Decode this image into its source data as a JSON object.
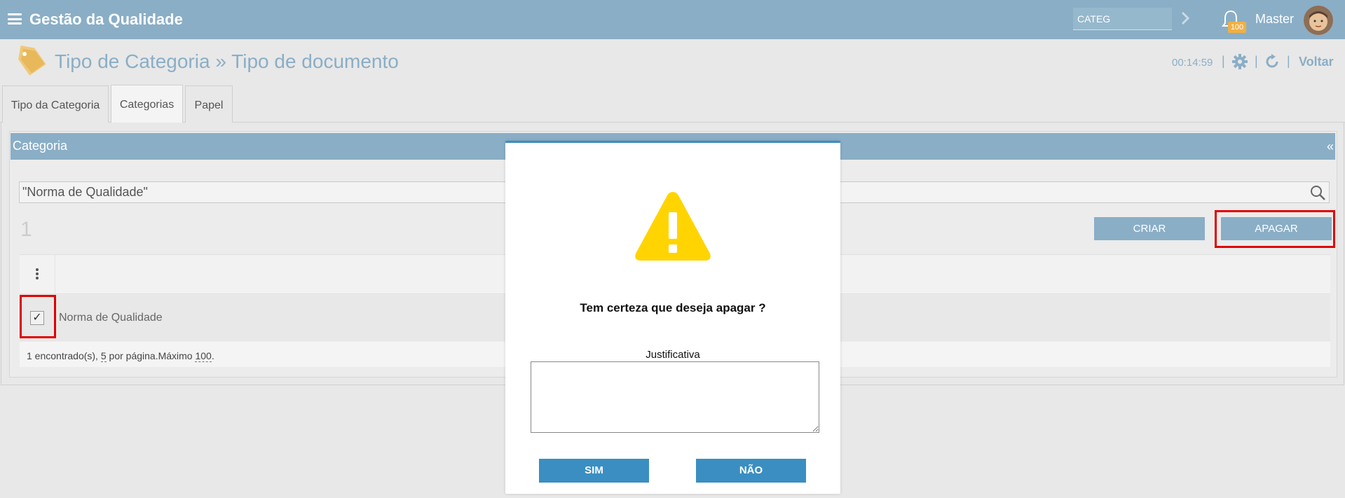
{
  "header": {
    "title": "Gestão da Qualidade",
    "search_value": "CATEG",
    "notification_count": "100",
    "user_name": "Master"
  },
  "page": {
    "title": "Tipo de Categoria » Tipo de documento",
    "timer": "00:14:59",
    "separator": "|",
    "back_label": "Voltar"
  },
  "tabs": [
    {
      "label": "Tipo da Categoria"
    },
    {
      "label": "Categorias"
    },
    {
      "label": "Papel"
    }
  ],
  "panel": {
    "title": "Categoria",
    "collapse": "«",
    "filter_value": "\"Norma de Qualidade\"",
    "count": "1",
    "create_label": "CRIAR",
    "delete_label": "APAGAR",
    "rows": [
      {
        "name": "Norma de Qualidade",
        "checked": "✓"
      }
    ],
    "footer": {
      "found": "1 encontrado(s), ",
      "per_page": "5",
      "per_page_text": " por página.Máximo ",
      "max": "100",
      "end": "."
    }
  },
  "modal": {
    "question": "Tem certeza que deseja apagar ?",
    "justification_label": "Justificativa",
    "yes_label": "SIM",
    "no_label": "NÃO"
  },
  "colors": {
    "header_bg": "#8aaec6",
    "modal_button": "#3b8ec1",
    "warning": "#ffd400",
    "highlight": "#e00000"
  }
}
